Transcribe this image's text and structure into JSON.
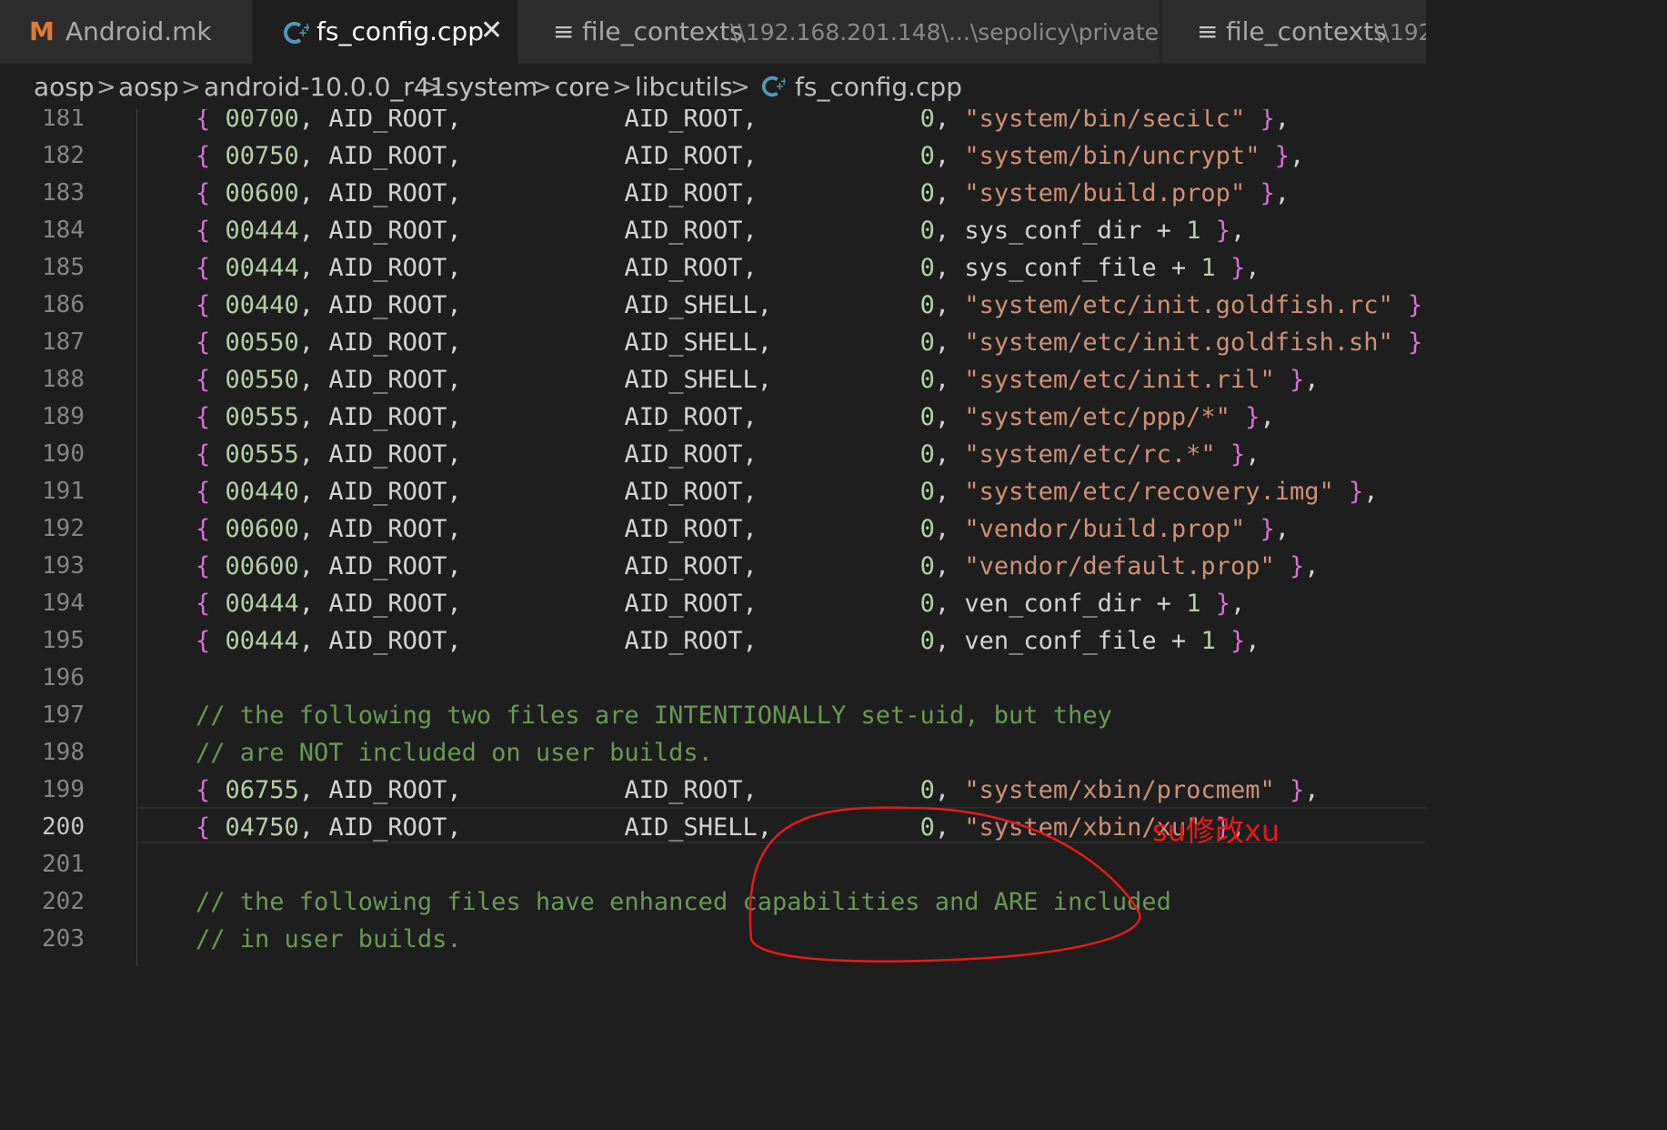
{
  "tabs": [
    {
      "label": "Android.mk",
      "icon": "makefile-icon",
      "icon_glyph": "M",
      "icon_color": "#e37933",
      "active": false
    },
    {
      "label": "fs_config.cpp",
      "icon": "cpp-icon",
      "icon_glyph": "G",
      "icon_color": "#519aba",
      "active": true,
      "close": "✕"
    },
    {
      "label": "file_contexts",
      "icon": "text-file-icon",
      "icon_glyph": "≡",
      "description": "\\\\192.168.201.148\\...\\sepolicy\\private",
      "active": false
    },
    {
      "label": "file_contexts",
      "icon": "text-file-icon",
      "icon_glyph": "≡",
      "description": "\\\\192",
      "active": false
    }
  ],
  "breadcrumb": [
    "aosp",
    "aosp",
    "android-10.0.0_r41",
    "system",
    "core",
    "libcutils",
    "fs_config.cpp"
  ],
  "breadcrumb_separator": ">",
  "current_line": "200",
  "lines": [
    {
      "n": "181",
      "mode": "00700",
      "uid": "AID_ROOT,",
      "gid": "AID_ROOT,",
      "caps": "0",
      "path": "\"system/bin/secilc\""
    },
    {
      "n": "182",
      "mode": "00750",
      "uid": "AID_ROOT,",
      "gid": "AID_ROOT,",
      "caps": "0",
      "path": "\"system/bin/uncrypt\""
    },
    {
      "n": "183",
      "mode": "00600",
      "uid": "AID_ROOT,",
      "gid": "AID_ROOT,",
      "caps": "0",
      "path": "\"system/build.prop\""
    },
    {
      "n": "184",
      "mode": "00444",
      "uid": "AID_ROOT,",
      "gid": "AID_ROOT,",
      "caps": "0",
      "expr": "sys_conf_dir + ",
      "one": "1"
    },
    {
      "n": "185",
      "mode": "00444",
      "uid": "AID_ROOT,",
      "gid": "AID_ROOT,",
      "caps": "0",
      "expr": "sys_conf_file + ",
      "one": "1"
    },
    {
      "n": "186",
      "mode": "00440",
      "uid": "AID_ROOT,",
      "gid": "AID_SHELL,",
      "caps": "0",
      "path": "\"system/etc/init.goldfish.rc\""
    },
    {
      "n": "187",
      "mode": "00550",
      "uid": "AID_ROOT,",
      "gid": "AID_SHELL,",
      "caps": "0",
      "path": "\"system/etc/init.goldfish.sh\""
    },
    {
      "n": "188",
      "mode": "00550",
      "uid": "AID_ROOT,",
      "gid": "AID_SHELL,",
      "caps": "0",
      "path": "\"system/etc/init.ril\""
    },
    {
      "n": "189",
      "mode": "00555",
      "uid": "AID_ROOT,",
      "gid": "AID_ROOT,",
      "caps": "0",
      "path": "\"system/etc/ppp/*\""
    },
    {
      "n": "190",
      "mode": "00555",
      "uid": "AID_ROOT,",
      "gid": "AID_ROOT,",
      "caps": "0",
      "path": "\"system/etc/rc.*\""
    },
    {
      "n": "191",
      "mode": "00440",
      "uid": "AID_ROOT,",
      "gid": "AID_ROOT,",
      "caps": "0",
      "path": "\"system/etc/recovery.img\""
    },
    {
      "n": "192",
      "mode": "00600",
      "uid": "AID_ROOT,",
      "gid": "AID_ROOT,",
      "caps": "0",
      "path": "\"vendor/build.prop\""
    },
    {
      "n": "193",
      "mode": "00600",
      "uid": "AID_ROOT,",
      "gid": "AID_ROOT,",
      "caps": "0",
      "path": "\"vendor/default.prop\""
    },
    {
      "n": "194",
      "mode": "00444",
      "uid": "AID_ROOT,",
      "gid": "AID_ROOT,",
      "caps": "0",
      "expr": "ven_conf_dir + ",
      "one": "1"
    },
    {
      "n": "195",
      "mode": "00444",
      "uid": "AID_ROOT,",
      "gid": "AID_ROOT,",
      "caps": "0",
      "expr": "ven_conf_file + ",
      "one": "1"
    },
    {
      "n": "196"
    },
    {
      "n": "197",
      "comment": "// the following two files are INTENTIONALLY set-uid, but they"
    },
    {
      "n": "198",
      "comment": "// are NOT included on user builds."
    },
    {
      "n": "199",
      "mode": "06755",
      "uid": "AID_ROOT,",
      "gid": "AID_ROOT,",
      "caps": "0",
      "path": "\"system/xbin/procmem\""
    },
    {
      "n": "200",
      "mode": "04750",
      "uid": "AID_ROOT,",
      "gid": "AID_SHELL,",
      "caps": "0",
      "path": "\"system/xbin/xu\""
    },
    {
      "n": "201"
    },
    {
      "n": "202",
      "comment": "// the following files have enhanced capabilities and ARE included"
    },
    {
      "n": "203",
      "comment": "// in user builds."
    }
  ],
  "annotation": {
    "text": "su修改xu",
    "color": "#e81a1a"
  },
  "colors": {
    "bracket": "#da70d6",
    "number": "#b5cea8",
    "string": "#ce9178",
    "comment": "#6a9955",
    "text": "#d4d4d4"
  }
}
